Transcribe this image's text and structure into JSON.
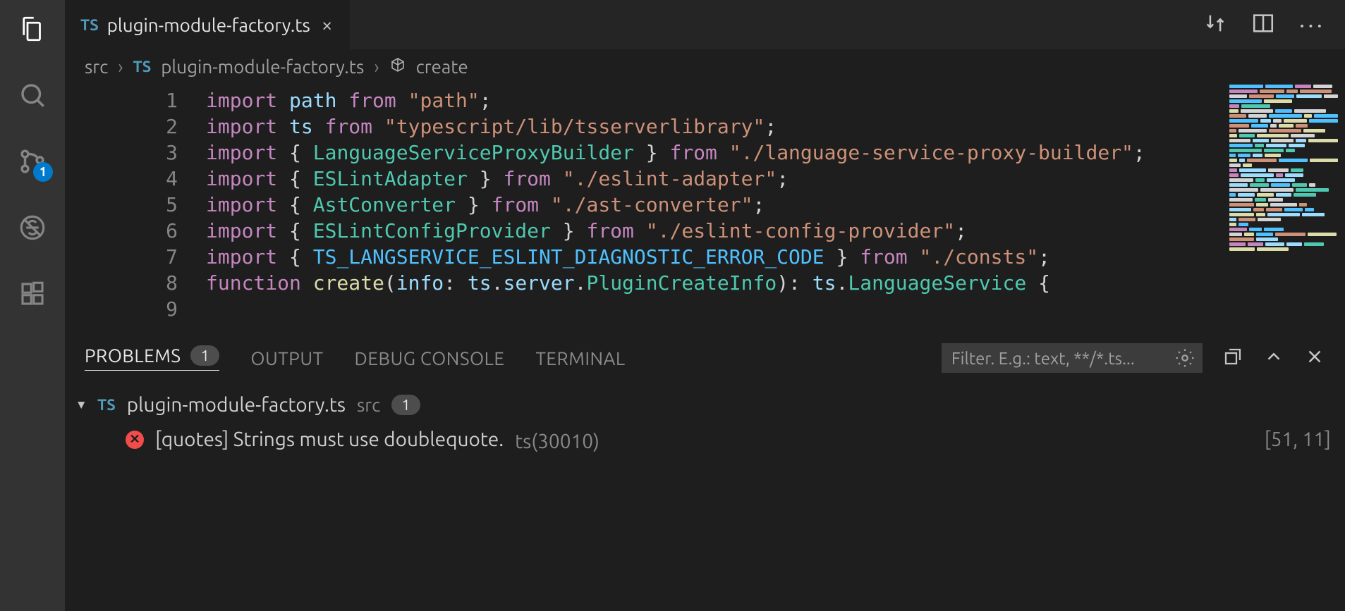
{
  "activityBar": {
    "scmBadge": "1"
  },
  "tab": {
    "language": "TS",
    "filename": "plugin-module-factory.ts"
  },
  "breadcrumbs": {
    "folder": "src",
    "language": "TS",
    "filename": "plugin-module-factory.ts",
    "symbol": "create"
  },
  "editor": {
    "lineNumbers": [
      "1",
      "2",
      "3",
      "4",
      "5",
      "6",
      "7",
      "8",
      "9"
    ],
    "lines": [
      [
        {
          "c": "kw",
          "t": "import"
        },
        {
          "c": "punc",
          "t": " "
        },
        {
          "c": "ident",
          "t": "path"
        },
        {
          "c": "punc",
          "t": " "
        },
        {
          "c": "kw",
          "t": "from"
        },
        {
          "c": "punc",
          "t": " "
        },
        {
          "c": "str",
          "t": "\"path\""
        },
        {
          "c": "punc",
          "t": ";"
        }
      ],
      [
        {
          "c": "kw",
          "t": "import"
        },
        {
          "c": "punc",
          "t": " "
        },
        {
          "c": "ident",
          "t": "ts"
        },
        {
          "c": "punc",
          "t": " "
        },
        {
          "c": "kw",
          "t": "from"
        },
        {
          "c": "punc",
          "t": " "
        },
        {
          "c": "str",
          "t": "\"typescript/lib/tsserverlibrary\""
        },
        {
          "c": "punc",
          "t": ";"
        }
      ],
      [
        {
          "c": "kw",
          "t": "import"
        },
        {
          "c": "punc",
          "t": " { "
        },
        {
          "c": "type",
          "t": "LanguageServiceProxyBuilder"
        },
        {
          "c": "punc",
          "t": " } "
        },
        {
          "c": "kw",
          "t": "from"
        },
        {
          "c": "punc",
          "t": " "
        },
        {
          "c": "str",
          "t": "\"./language-service-proxy-builder\""
        },
        {
          "c": "punc",
          "t": ";"
        }
      ],
      [
        {
          "c": "kw",
          "t": "import"
        },
        {
          "c": "punc",
          "t": " { "
        },
        {
          "c": "type",
          "t": "ESLintAdapter"
        },
        {
          "c": "punc",
          "t": " } "
        },
        {
          "c": "kw",
          "t": "from"
        },
        {
          "c": "punc",
          "t": " "
        },
        {
          "c": "str",
          "t": "\"./eslint-adapter\""
        },
        {
          "c": "punc",
          "t": ";"
        }
      ],
      [
        {
          "c": "kw",
          "t": "import"
        },
        {
          "c": "punc",
          "t": " { "
        },
        {
          "c": "type",
          "t": "AstConverter"
        },
        {
          "c": "punc",
          "t": " } "
        },
        {
          "c": "kw",
          "t": "from"
        },
        {
          "c": "punc",
          "t": " "
        },
        {
          "c": "str",
          "t": "\"./ast-converter\""
        },
        {
          "c": "punc",
          "t": ";"
        }
      ],
      [
        {
          "c": "kw",
          "t": "import"
        },
        {
          "c": "punc",
          "t": " { "
        },
        {
          "c": "type",
          "t": "ESLintConfigProvider"
        },
        {
          "c": "punc",
          "t": " } "
        },
        {
          "c": "kw",
          "t": "from"
        },
        {
          "c": "punc",
          "t": " "
        },
        {
          "c": "str",
          "t": "\"./eslint-config-provider\""
        },
        {
          "c": "punc",
          "t": ";"
        }
      ],
      [
        {
          "c": "kw",
          "t": "import"
        },
        {
          "c": "punc",
          "t": " { "
        },
        {
          "c": "const",
          "t": "TS_LANGSERVICE_ESLINT_DIAGNOSTIC_ERROR_CODE"
        },
        {
          "c": "punc",
          "t": " } "
        },
        {
          "c": "kw",
          "t": "from"
        },
        {
          "c": "punc",
          "t": " "
        },
        {
          "c": "str",
          "t": "\"./consts\""
        },
        {
          "c": "punc",
          "t": ";"
        }
      ],
      [
        {
          "c": "punc",
          "t": ""
        }
      ],
      [
        {
          "c": "kw",
          "t": "function"
        },
        {
          "c": "punc",
          "t": " "
        },
        {
          "c": "fn",
          "t": "create"
        },
        {
          "c": "punc",
          "t": "("
        },
        {
          "c": "ident",
          "t": "info"
        },
        {
          "c": "punc",
          "t": ": "
        },
        {
          "c": "ident",
          "t": "ts"
        },
        {
          "c": "punc",
          "t": "."
        },
        {
          "c": "ident",
          "t": "server"
        },
        {
          "c": "punc",
          "t": "."
        },
        {
          "c": "type",
          "t": "PluginCreateInfo"
        },
        {
          "c": "punc",
          "t": "): "
        },
        {
          "c": "ident",
          "t": "ts"
        },
        {
          "c": "punc",
          "t": "."
        },
        {
          "c": "type",
          "t": "LanguageService"
        },
        {
          "c": "punc",
          "t": " {"
        }
      ]
    ]
  },
  "panel": {
    "tabs": {
      "problems": "PROBLEMS",
      "problemsCount": "1",
      "output": "OUTPUT",
      "debug": "DEBUG CONSOLE",
      "terminal": "TERMINAL"
    },
    "filterPlaceholder": "Filter. E.g.: text, **/*.ts...",
    "problemFile": {
      "language": "TS",
      "name": "plugin-module-factory.ts",
      "folder": "src",
      "count": "1"
    },
    "problem": {
      "message": "[quotes] Strings must use doublequote.",
      "code": "ts(30010)",
      "location": "[51, 11]"
    }
  }
}
